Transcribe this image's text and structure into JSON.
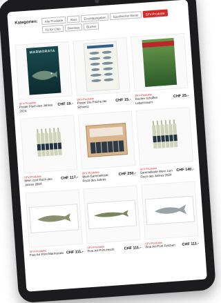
{
  "filter": {
    "label": "Kategorien:",
    "tags": [
      "Alle Produkte",
      "Abos",
      "Einzelausgaben",
      "Sportfischer-Boxer",
      "SFV-Produkte",
      "F1 for Club",
      "Diverses",
      "Bücher"
    ],
    "active": "SFV-Produkte"
  },
  "products": [
    {
      "category": "SFV-Produkte",
      "name": "Poster Fisch des Jahres 2024",
      "price": "CHF 19.-",
      "poster_title": "MARMORATA"
    },
    {
      "category": "SFV-Produkte",
      "name": "Poster Die Fische der Schweiz",
      "price": "CHF 15.-"
    },
    {
      "category": "SFV-Produkte",
      "name": "Fischer schaffen Lebensraum",
      "price": "CHF 25.-"
    },
    {
      "category": "SFV-Produkte",
      "name": "Wein zum Fisch des Jahres 2024",
      "price": "CHF 117.-"
    },
    {
      "category": "SFV-Produkte",
      "name": "Wein-Sammelkiste: Fisch des Jahres",
      "price": "CHF 250.-"
    },
    {
      "category": "SFV-Produkte",
      "name": "Sammelkiste Wein zum Fisch des Jahres 2024",
      "price": "CHF 140.-"
    },
    {
      "category": "SFV-Produkte",
      "name": "Fine Art Print Marmorata",
      "price": "CHF 111.-"
    },
    {
      "category": "SFV-Produkte",
      "name": "Fine Art Print Hecht",
      "price": "CHF 111.-"
    },
    {
      "category": "SFV-Produkte",
      "name": "Fine Art Print Felchen",
      "price": "CHF 111.-"
    }
  ]
}
